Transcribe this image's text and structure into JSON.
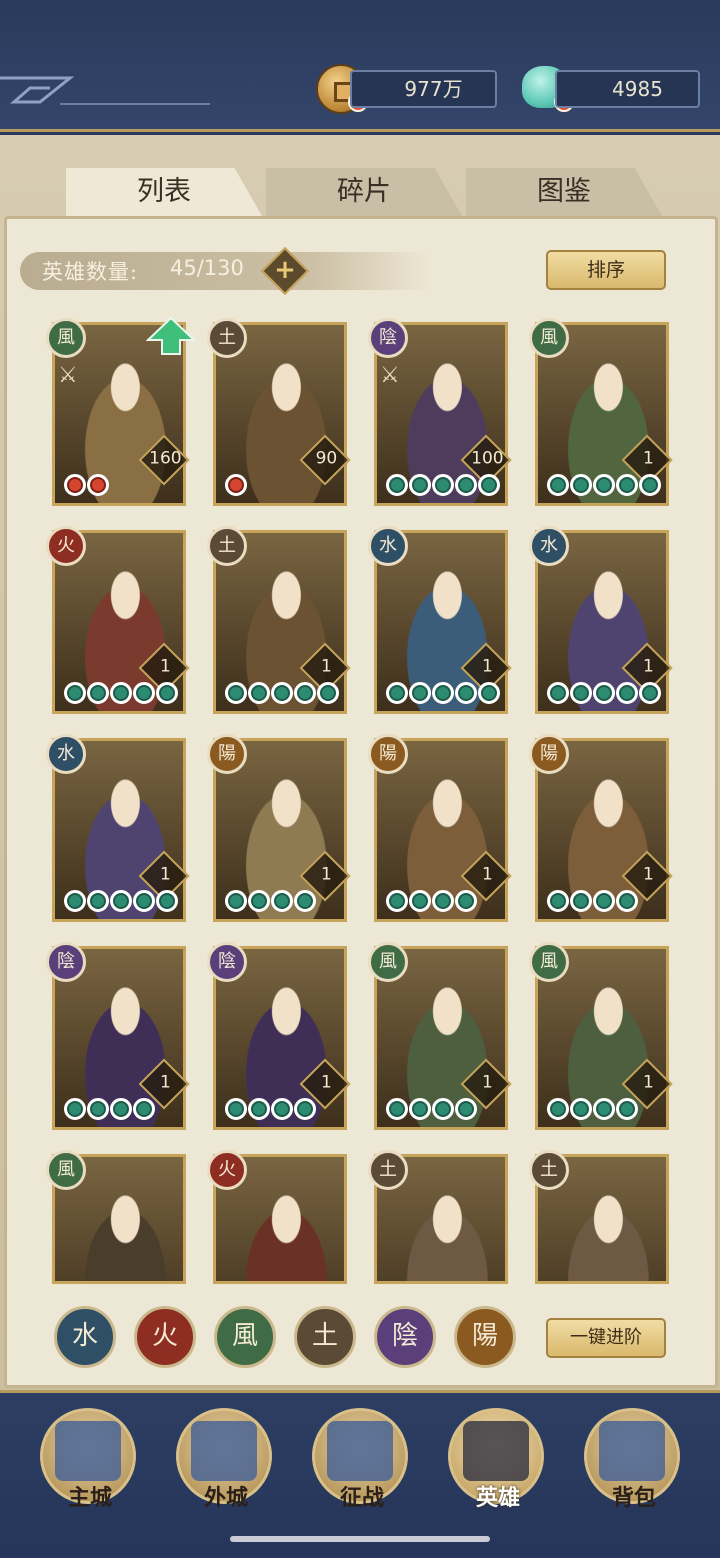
{
  "currency": {
    "coins": "977万",
    "gems": "4985"
  },
  "tabs": [
    {
      "label": "列表",
      "active": true
    },
    {
      "label": "碎片",
      "active": false
    },
    {
      "label": "图鉴",
      "active": false
    }
  ],
  "hero_count": {
    "label": "英雄数量:",
    "value": "45/130"
  },
  "sort_button": "排序",
  "elements": {
    "wind": {
      "glyph": "風",
      "color": "#3f6b45"
    },
    "earth": {
      "glyph": "土",
      "color": "#5b4a36"
    },
    "yin": {
      "glyph": "陰",
      "color": "#5b3f7a"
    },
    "fire": {
      "glyph": "火",
      "color": "#8e2e22"
    },
    "water": {
      "glyph": "水",
      "color": "#2f4f66"
    },
    "yang": {
      "glyph": "陽",
      "color": "#8a5a20"
    }
  },
  "heroes": [
    {
      "element": "wind",
      "level": "160",
      "stars": 2,
      "star_color": "red",
      "upgrade_available": true,
      "equipped_icon": true
    },
    {
      "element": "earth",
      "level": "90",
      "stars": 1,
      "star_color": "red"
    },
    {
      "element": "yin",
      "level": "100",
      "stars": 5,
      "star_color": "green",
      "equipped_icon": true
    },
    {
      "element": "wind",
      "level": "1",
      "stars": 5,
      "star_color": "green"
    },
    {
      "element": "fire",
      "level": "1",
      "stars": 5,
      "star_color": "green"
    },
    {
      "element": "earth",
      "level": "1",
      "stars": 5,
      "star_color": "green"
    },
    {
      "element": "water",
      "level": "1",
      "stars": 5,
      "star_color": "green"
    },
    {
      "element": "water",
      "level": "1",
      "stars": 5,
      "star_color": "green"
    },
    {
      "element": "water",
      "level": "1",
      "stars": 5,
      "star_color": "green"
    },
    {
      "element": "yang",
      "level": "1",
      "stars": 4,
      "star_color": "green"
    },
    {
      "element": "yang",
      "level": "1",
      "stars": 4,
      "star_color": "green"
    },
    {
      "element": "yang",
      "level": "1",
      "stars": 4,
      "star_color": "green"
    },
    {
      "element": "yin",
      "level": "1",
      "stars": 4,
      "star_color": "green"
    },
    {
      "element": "yin",
      "level": "1",
      "stars": 4,
      "star_color": "green"
    },
    {
      "element": "wind",
      "level": "1",
      "stars": 4,
      "star_color": "green"
    },
    {
      "element": "wind",
      "level": "1",
      "stars": 4,
      "star_color": "green"
    },
    {
      "element": "wind"
    },
    {
      "element": "fire"
    },
    {
      "element": "earth"
    },
    {
      "element": "earth"
    }
  ],
  "filter_buttons": [
    {
      "element": "water",
      "glyph": "水"
    },
    {
      "element": "fire",
      "glyph": "火"
    },
    {
      "element": "wind",
      "glyph": "風"
    },
    {
      "element": "earth",
      "glyph": "土"
    },
    {
      "element": "yin",
      "glyph": "陰"
    },
    {
      "element": "yang",
      "glyph": "陽"
    }
  ],
  "promote_button": "一键进阶",
  "nav": [
    {
      "label": "主城",
      "active": false
    },
    {
      "label": "外城",
      "active": false
    },
    {
      "label": "征战",
      "active": false
    },
    {
      "label": "英雄",
      "active": true
    },
    {
      "label": "背包",
      "active": false
    }
  ]
}
